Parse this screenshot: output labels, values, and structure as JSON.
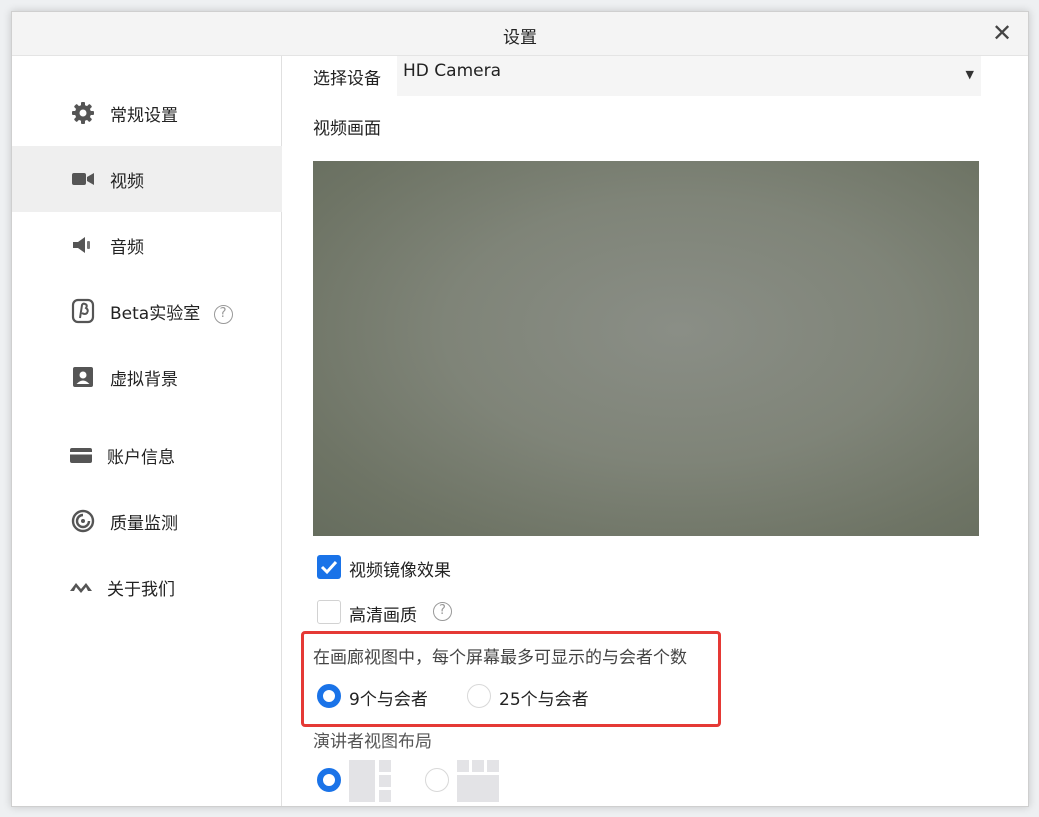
{
  "window": {
    "title": "设置",
    "close_glyph": "✕"
  },
  "sidebar": {
    "items": [
      {
        "label": "常规设置",
        "icon": "gear-icon"
      },
      {
        "label": "视频",
        "icon": "video-camera-icon",
        "active": true
      },
      {
        "label": "音频",
        "icon": "speaker-icon"
      },
      {
        "label": "Beta实验室",
        "icon": "beta-icon",
        "help": "?"
      },
      {
        "label": "虚拟背景",
        "icon": "portrait-icon"
      },
      {
        "label": "账户信息",
        "icon": "card-icon"
      },
      {
        "label": "质量监测",
        "icon": "gauge-icon"
      },
      {
        "label": "关于我们",
        "icon": "logo-icon"
      }
    ]
  },
  "content": {
    "device_label": "选择设备",
    "device_value": "HD Camera",
    "device_arrow": "▼",
    "preview_label": "视频画面",
    "mirror": {
      "label": "视频镜像效果",
      "checked": true
    },
    "hd": {
      "label": "高清画质",
      "checked": false,
      "help": "?"
    },
    "gallery": {
      "label": "在画廊视图中，每个屏幕最多可显示的与会者个数",
      "options": [
        {
          "label": "9个与会者",
          "selected": true
        },
        {
          "label": "25个与会者",
          "selected": false
        }
      ]
    },
    "speaker_layout": {
      "label": "演讲者视图布局",
      "selected_index": 0
    }
  },
  "colors": {
    "accent": "#1a73e8",
    "highlight": "#e53935"
  }
}
